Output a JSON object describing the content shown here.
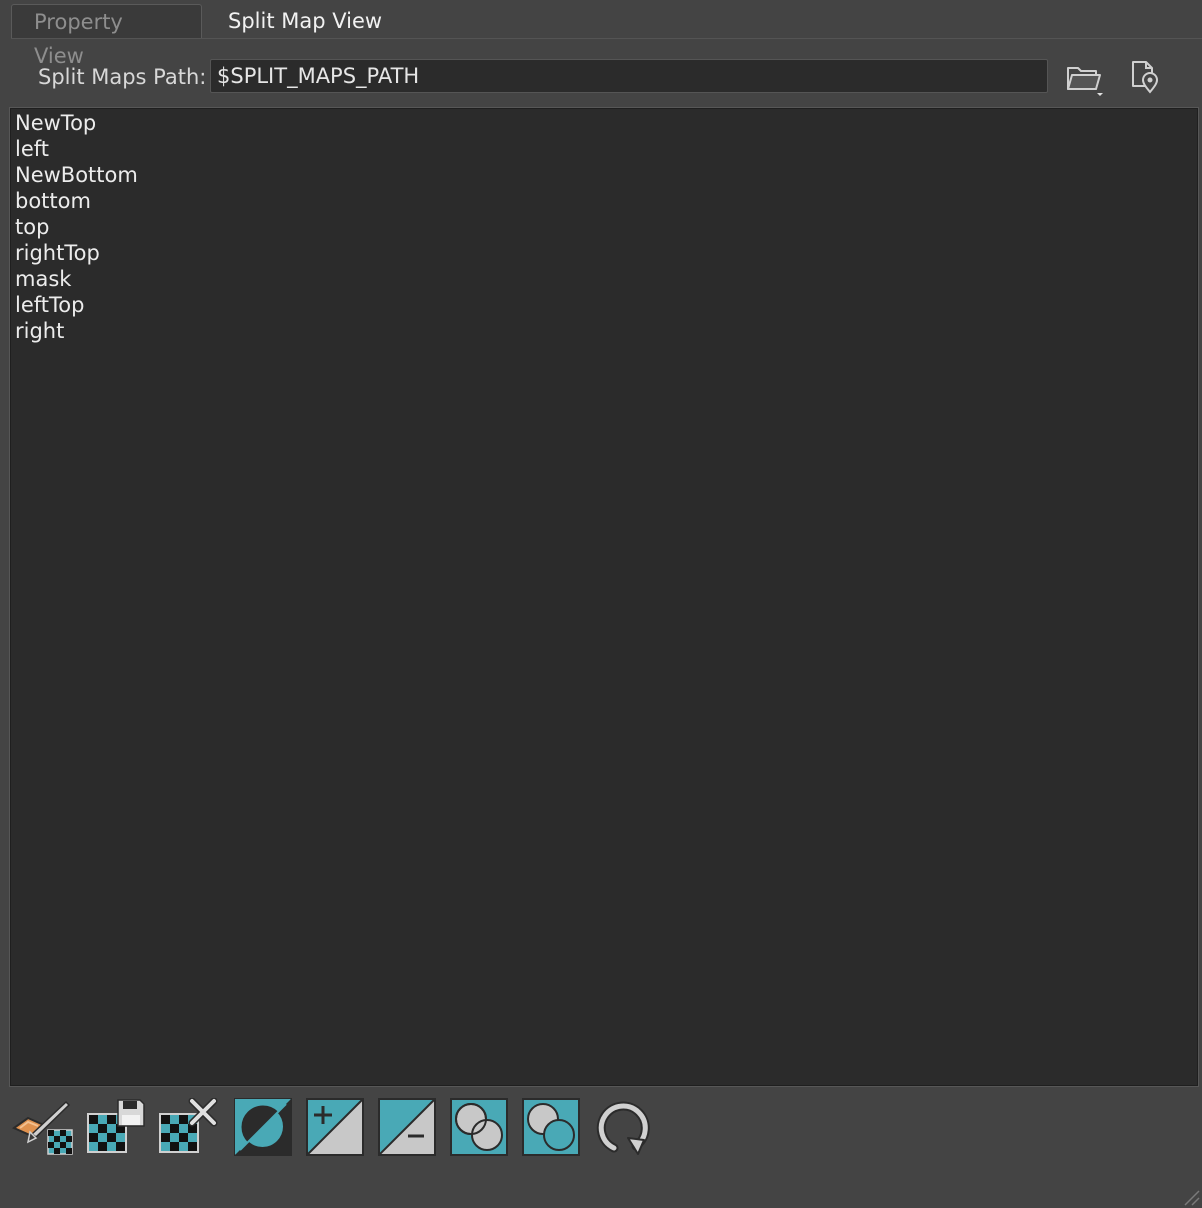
{
  "tabs": [
    {
      "label": "Property View",
      "active": false
    },
    {
      "label": "Split Map View",
      "active": true
    }
  ],
  "path": {
    "label": "Split Maps Path:",
    "value": "$SPLIT_MAPS_PATH"
  },
  "split_maps": [
    "NewTop",
    "left",
    "NewBottom",
    "bottom",
    "top",
    "rightTop",
    "mask",
    "leftTop",
    "right"
  ],
  "toolbar_icons": [
    "paint-split-map-icon",
    "save-split-map-icon",
    "delete-split-map-icon",
    "invert-icon",
    "add-icon",
    "subtract-icon",
    "intersect-icon",
    "union-icon",
    "refresh-icon"
  ],
  "colors": {
    "accent_teal": "#49a9b6",
    "panel_bg": "#444444",
    "list_bg": "#2b2b2b",
    "paint_orange": "#e0924f"
  }
}
